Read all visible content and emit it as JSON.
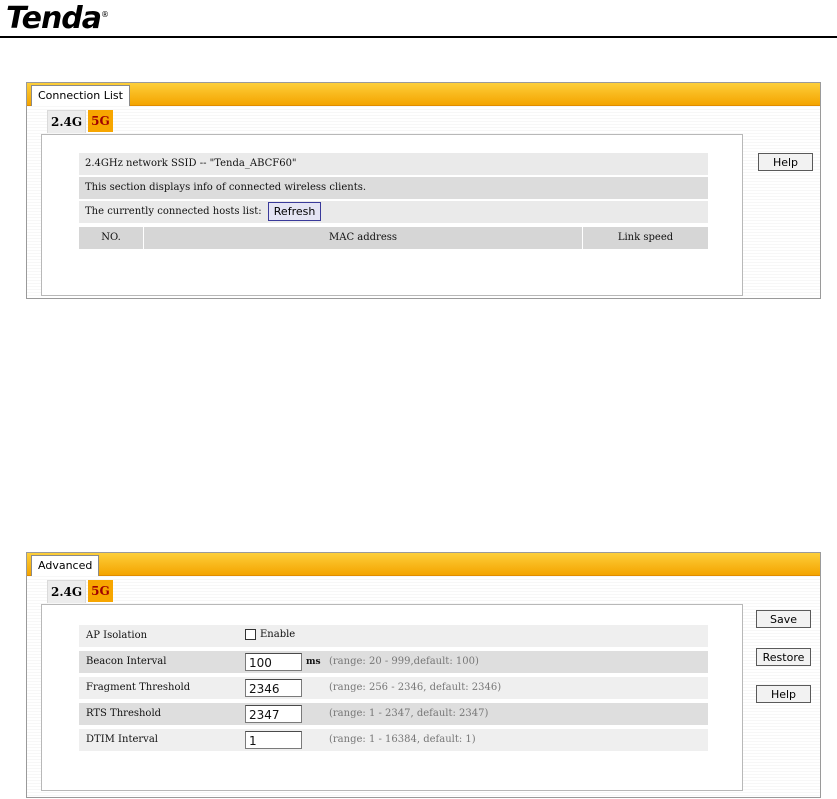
{
  "brand": {
    "name": "Tenda",
    "mark": "®"
  },
  "connection_panel": {
    "tab_label": "Connection List",
    "subtabs": [
      "2.4G",
      "5G"
    ],
    "ssid_text": "2.4GHz network SSID -- \"Tenda_ABCF60\"",
    "info_text": "This section displays info of connected wireless clients.",
    "hosts_label": "The currently connected hosts list:",
    "refresh_label": "Refresh",
    "columns": [
      "NO.",
      "MAC address",
      "Link speed"
    ],
    "help_label": "Help"
  },
  "advanced_panel": {
    "tab_label": "Advanced",
    "subtabs": [
      "2.4G",
      "5G"
    ],
    "fields": [
      {
        "label": "AP Isolation",
        "checkbox_label": "Enable",
        "checked": false
      },
      {
        "label": "Beacon Interval",
        "value": "100",
        "unit": "ms",
        "hint": "(range: 20 - 999,default: 100)"
      },
      {
        "label": "Fragment Threshold",
        "value": "2346",
        "hint": "(range: 256 - 2346, default: 2346)"
      },
      {
        "label": "RTS Threshold",
        "value": "2347",
        "hint": "(range: 1 - 2347, default: 2347)"
      },
      {
        "label": "DTIM Interval",
        "value": "1",
        "hint": "(range: 1 - 16384, default: 1)"
      }
    ],
    "buttons": {
      "save": "Save",
      "restore": "Restore",
      "help": "Help"
    }
  }
}
